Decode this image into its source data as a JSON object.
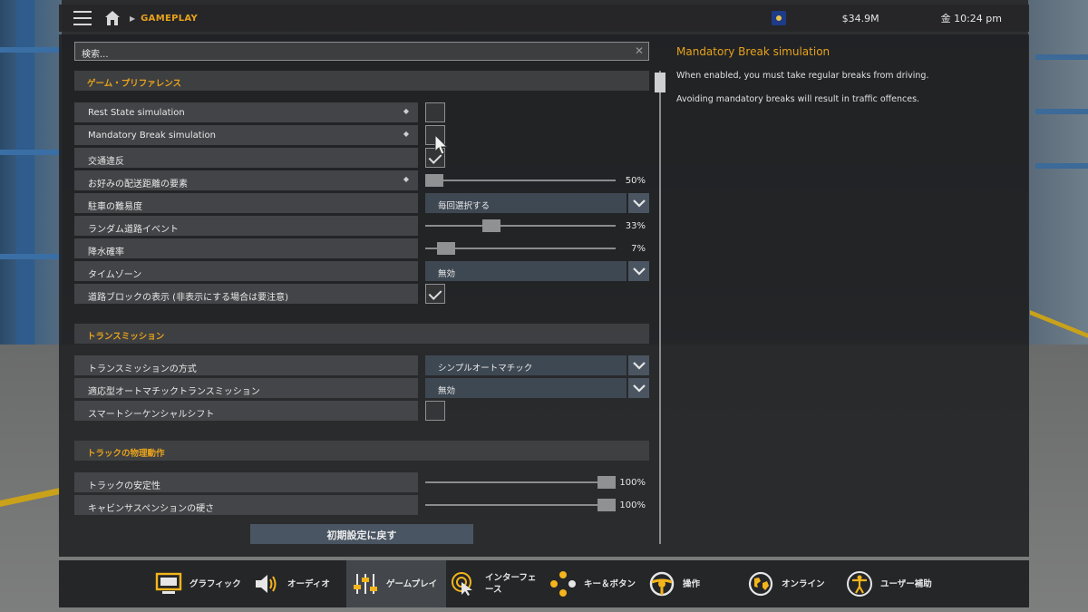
{
  "topbar": {
    "breadcrumb": "GAMEPLAY",
    "money": "$34.9M",
    "time": "金 10:24 pm"
  },
  "search": {
    "placeholder": "検索..."
  },
  "sections": {
    "prefs": "ゲーム・プリファレンス",
    "transmission": "トランスミッション",
    "physics": "トラックの物理動作"
  },
  "settings": {
    "rest_state": {
      "label": "Rest State simulation",
      "checked": false
    },
    "mandatory_break": {
      "label": "Mandatory Break simulation",
      "checked": false
    },
    "traffic": {
      "label": "交通違反",
      "checked": true
    },
    "delivery_distance": {
      "label": "お好みの配送距離の要素",
      "value": "50%",
      "level": 0
    },
    "parking": {
      "label": "駐車の難易度",
      "value": "毎回選択する"
    },
    "random_events": {
      "label": "ランダム道路イベント",
      "value": "33%",
      "level": 0.33
    },
    "rain": {
      "label": "降水確率",
      "value": "7%",
      "level": 0.07
    },
    "timezone": {
      "label": "タイムゾーン",
      "value": "無効"
    },
    "roadblock": {
      "label": "道路ブロックの表示 (非表示にする場合は要注意)",
      "checked": true
    },
    "transmission_type": {
      "label": "トランスミッションの方式",
      "value": "シンプルオートマチック"
    },
    "adaptive": {
      "label": "適応型オートマチックトランスミッション",
      "value": "無効"
    },
    "smart_shift": {
      "label": "スマートシーケンシャルシフト",
      "checked": false
    },
    "truck_stability": {
      "label": "トラックの安定性",
      "value": "100%",
      "level": 1
    },
    "cabin_suspension": {
      "label": "キャビンサスペンションの硬さ",
      "value": "100%",
      "level": 1
    }
  },
  "reset_label": "初期設定に戻す",
  "help": {
    "title": "Mandatory Break simulation",
    "p1": "When enabled, you must take regular breaks from driving.",
    "p2": "Avoiding mandatory breaks will result in traffic offences."
  },
  "tabs": [
    {
      "label": "グラフィック",
      "icon": "monitor-icon"
    },
    {
      "label": "オーディオ",
      "icon": "speaker-icon"
    },
    {
      "label": "ゲームプレイ",
      "icon": "sliders-icon",
      "active": true
    },
    {
      "label": "インターフェース",
      "line1": "インターフェ",
      "line2": "ース",
      "icon": "cursor-click-icon"
    },
    {
      "label": "キー＆ボタン",
      "icon": "gamepad-buttons-icon"
    },
    {
      "label": "操作",
      "icon": "steering-wheel-icon"
    },
    {
      "label": "オンライン",
      "icon": "globe-icon"
    },
    {
      "label": "ユーザー補助",
      "icon": "accessibility-icon"
    }
  ],
  "colors": {
    "accent": "#e7a21c",
    "dropdown": "#3e4853",
    "icon_yellow": "#f3b51b"
  }
}
